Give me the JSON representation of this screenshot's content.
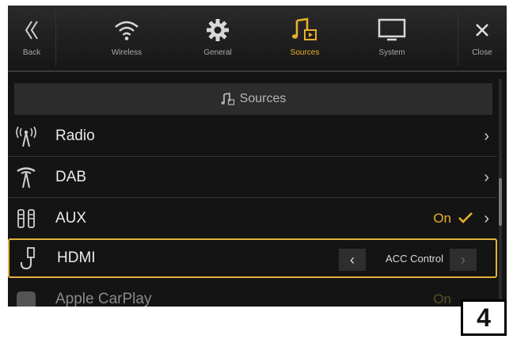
{
  "topbar": {
    "items": [
      {
        "label": "Back",
        "icon": "back-chevrons-icon"
      },
      {
        "label": "Wireless",
        "icon": "wifi-icon"
      },
      {
        "label": "General",
        "icon": "gear-icon"
      },
      {
        "label": "Sources",
        "icon": "music-source-icon",
        "active": true
      },
      {
        "label": "System",
        "icon": "monitor-icon"
      },
      {
        "label": "Close",
        "icon": "close-icon"
      }
    ]
  },
  "header": {
    "title": "Sources"
  },
  "rows": [
    {
      "label": "Radio"
    },
    {
      "label": "DAB"
    },
    {
      "label": "AUX",
      "value": "On"
    },
    {
      "label": "HDMI",
      "value": "ACC Control"
    },
    {
      "label": "Apple CarPlay",
      "value": "On"
    }
  ],
  "figure_number": "4",
  "colors": {
    "accent": "#e9b12a",
    "highlight": "#e1b23a",
    "background": "#141414"
  }
}
